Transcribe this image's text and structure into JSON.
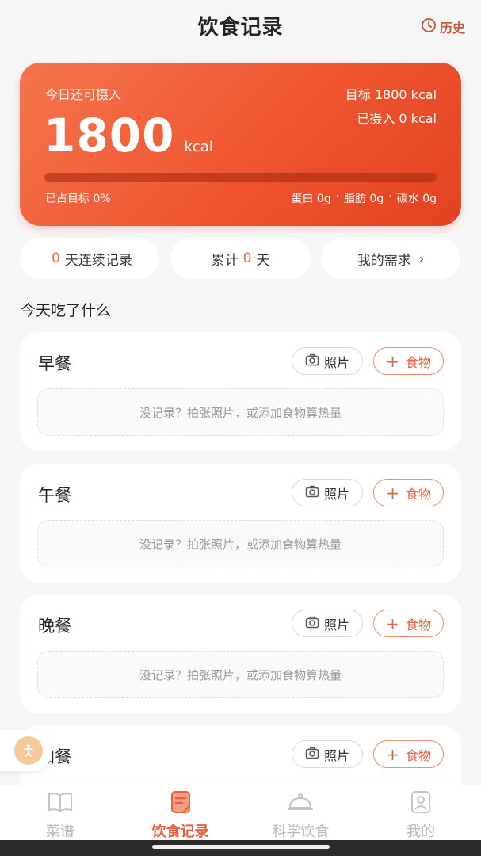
{
  "header": {
    "title": "饮食记录",
    "history_label": "历史"
  },
  "summary": {
    "remaining_label": "今日还可摄入",
    "remaining_value": "1800",
    "unit": "kcal",
    "target_text": "目标 1800 kcal",
    "eaten_text": "已摄入 0 kcal",
    "progress_fraction": 0,
    "percent_text": "已占目标 0%",
    "macros": [
      "蛋白 0g",
      "脂肪 0g",
      "碳水 0g"
    ],
    "macro_separator": "·",
    "accent_color": "#ee5530"
  },
  "stats": {
    "streak_value": "0",
    "streak_label": "天连续记录",
    "total_prefix": "累计",
    "total_value": "0",
    "total_suffix": "天",
    "needs_label": "我的需求",
    "needs_chevron": "›"
  },
  "section_title": "今天吃了什么",
  "meals": [
    {
      "name": "早餐",
      "photo_label": "照片",
      "food_label": "食物",
      "empty_text": "没记录？拍张照片，或添加食物算热量"
    },
    {
      "name": "午餐",
      "photo_label": "照片",
      "food_label": "食物",
      "empty_text": "没记录？拍张照片，或添加食物算热量"
    },
    {
      "name": "晚餐",
      "photo_label": "照片",
      "food_label": "食物",
      "empty_text": "没记录？拍张照片，或添加食物算热量"
    },
    {
      "name": "加餐",
      "photo_label": "照片",
      "food_label": "食物",
      "empty_text": ""
    }
  ],
  "tabs": [
    {
      "label": "菜谱",
      "icon": "book-icon"
    },
    {
      "label": "饮食记录",
      "icon": "note-icon",
      "active": true
    },
    {
      "label": "科学饮食",
      "icon": "dish-icon"
    },
    {
      "label": "我的",
      "icon": "profile-icon"
    }
  ]
}
